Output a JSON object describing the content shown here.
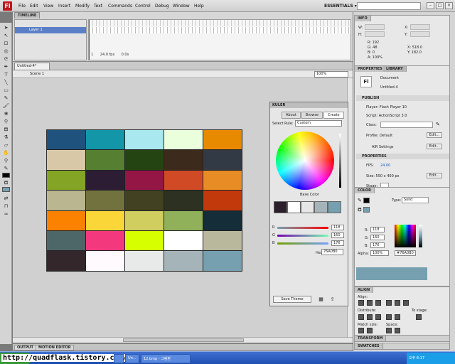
{
  "menubar": {
    "logo": "Fl",
    "items": [
      "File",
      "Edit",
      "View",
      "Insert",
      "Modify",
      "Text",
      "Commands",
      "Control",
      "Debug",
      "Window",
      "Help"
    ],
    "workspace": "ESSENTIALS ▾"
  },
  "timeline": {
    "tab": "TIMELINE",
    "layer_name": "Layer 1",
    "frame_rate": "24.0 fps",
    "time": "0.0s",
    "current_frame": "1"
  },
  "document": {
    "tab": "Untitled-4*",
    "scene": "Scene 1",
    "zoom": "100%"
  },
  "stage": {
    "grid_colors": [
      "#20527e",
      "#1396a8",
      "#a8e8ee",
      "#eaffdc",
      "#e88a00",
      "#d8c8a8",
      "#567f32",
      "#244512",
      "#3c2a1c",
      "#313a45",
      "#84a426",
      "#2c1d35",
      "#941645",
      "#d04a26",
      "#e88c26",
      "#bab690",
      "#71723e",
      "#424223",
      "#2c3121",
      "#c23a0c",
      "#fa8200",
      "#fad638",
      "#cfce5e",
      "#90b05a",
      "#152d38",
      "#4d6668",
      "#f4387e",
      "#d6ff00",
      "#ffffff",
      "#b9b89d",
      "#34272c",
      "#fefafe",
      "#e8eaea",
      "#a5b4b8",
      "#76a0b0"
    ]
  },
  "kuler": {
    "title": "KULER",
    "tabs": [
      "About",
      "Browse",
      "Create"
    ],
    "select_rule_label": "Select Rule:",
    "select_rule_value": "Custom",
    "base_color_label": "Base Color",
    "theme_swatches": [
      "#2a1f2a",
      "#ffffff",
      "#e6e6e6",
      "#a5b4b8",
      "#76a0b0"
    ],
    "channel_labels": [
      "R",
      "G",
      "B"
    ],
    "channel_values": [
      "118",
      "160",
      "176"
    ],
    "hex_label": "Hex:",
    "hex_value": "76A0B0",
    "save_theme": "Save Theme"
  },
  "info": {
    "tab": "INFO",
    "w_label": "W:",
    "w_value": "",
    "h_label": "H:",
    "h_value": "",
    "x_label": "X:",
    "x_value": "",
    "y_label": "Y:",
    "y_value": "",
    "r": "R: 192",
    "g": "G: 48",
    "b": "B: 0",
    "a": "A: 100%",
    "cx": "X: 518.0",
    "cy": "Y: 182.0"
  },
  "properties": {
    "tab": "PROPERTIES",
    "tab2": "LIBRARY",
    "fl_icon": "Fl",
    "doc_type": "Document",
    "doc_name": "Untitled-4",
    "publish": "PUBLISH",
    "player": "Player: Flash Player 10",
    "script": "Script: ActionScript 3.0",
    "class_label": "Class:",
    "profile": "Profile: Default",
    "edit1": "Edit...",
    "air": "AIR Settings",
    "edit2": "Edit...",
    "properties_section": "PROPERTIES",
    "fps_label": "FPS:",
    "fps_value": "24.00",
    "size": "Size: 550 x 400 px",
    "edit3": "Edit...",
    "stage_label": "Stage:"
  },
  "color": {
    "tab": "COLOR",
    "type_label": "Type:",
    "type_value": "Solid",
    "r_label": "R:",
    "r": "118",
    "g_label": "G:",
    "g": "160",
    "b_label": "B:",
    "b": "176",
    "alpha_label": "Alpha:",
    "alpha": "100%",
    "hex": "#76A0B0",
    "preview": "#76a0b0"
  },
  "align": {
    "tab": "ALIGN",
    "align_label": "Align:",
    "distribute_label": "Distribute:",
    "match_label": "Match size:",
    "space_label": "Space:",
    "to_stage": "To stage:"
  },
  "transform_tab": "TRANSFORM",
  "swatches_tab": "SWATCHES",
  "output": {
    "tab1": "OUTPUT",
    "tab2": "MOTION EDITOR"
  },
  "taskbar": {
    "url": "http://quadflask.tistory.com/",
    "tasks": [
      "",
      "Un...",
      "12.bmp - 그림판"
    ],
    "tray": "오후 8:17"
  }
}
